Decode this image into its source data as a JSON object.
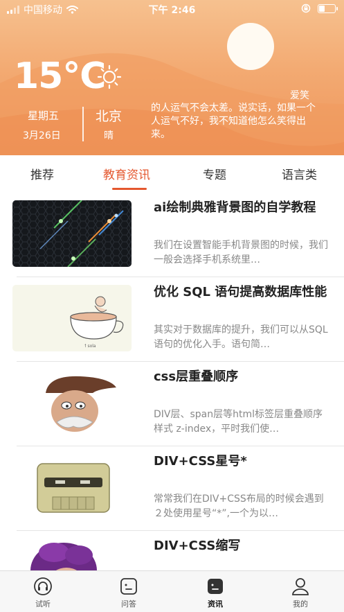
{
  "status_bar": {
    "carrier": "中国移动",
    "time": "下午 2:46",
    "battery_level": 0.35
  },
  "weather": {
    "temperature": "15℃",
    "weekday": "星期五",
    "date": "3月26日",
    "city": "北京",
    "condition": "晴",
    "icon": "sun-icon",
    "quote_tail": "爱笑",
    "quote": "的人运气不会太差。说实话，如果一个人运气不好，我不知道他怎么笑得出来。"
  },
  "tabs": [
    {
      "label": "推荐"
    },
    {
      "label": "教育资讯"
    },
    {
      "label": "专题"
    },
    {
      "label": "语言类"
    }
  ],
  "active_tab": "教育资讯",
  "articles": [
    {
      "title": "ai绘制典雅背景图的自学教程",
      "desc": "我们在设置智能手机背景图的时候，我们一般会选择手机系统里…"
    },
    {
      "title": "优化 SQL 语句提高数据库性能",
      "desc": "其实对于数据库的提升，我们可以从SQL 语句的优化入手。语句简…"
    },
    {
      "title": "css层重叠顺序",
      "desc": "DIV层、span层等html标签层重叠顺序样式 z-index，平时我们使…"
    },
    {
      "title": "DIV+CSS星号*",
      "desc": "常常我们在DIV+CSS布局的时候会遇到２处使用星号“*”,一个为以…"
    },
    {
      "title": "DIV+CSS缩写",
      "desc": ""
    }
  ],
  "bottom_nav": [
    {
      "label": "试听",
      "icon": "headphones-icon"
    },
    {
      "label": "问答",
      "icon": "chat-icon"
    },
    {
      "label": "资讯",
      "icon": "news-icon"
    },
    {
      "label": "我的",
      "icon": "user-icon"
    }
  ],
  "active_nav": "资讯",
  "colors": {
    "accent": "#e4572e",
    "header_top": "#f6c18f",
    "header_bottom": "#ee955a"
  }
}
